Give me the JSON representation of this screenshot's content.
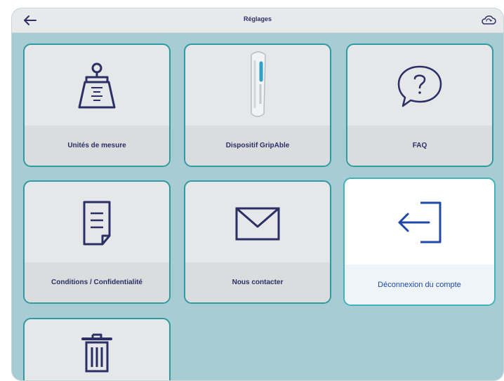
{
  "header": {
    "title": "Réglages"
  },
  "tiles": [
    {
      "label": "Unités de mesure",
      "icon": "weight-scale-icon"
    },
    {
      "label": "Dispositif GripAble",
      "icon": "gripable-device-image"
    },
    {
      "label": "FAQ",
      "icon": "question-bubble-icon"
    },
    {
      "label": "Conditions / Confidentialité",
      "icon": "document-icon"
    },
    {
      "label": "Nous contacter",
      "icon": "envelope-icon"
    },
    {
      "label": "Déconnexion du compte",
      "icon": "logout-icon",
      "selected": true
    },
    {
      "label": "",
      "icon": "trash-icon"
    }
  ],
  "colors": {
    "background": "#a8ccd3",
    "tile_border": "#2e9aa2",
    "icon": "#2b2f66",
    "selected_text": "#1f49a8"
  }
}
